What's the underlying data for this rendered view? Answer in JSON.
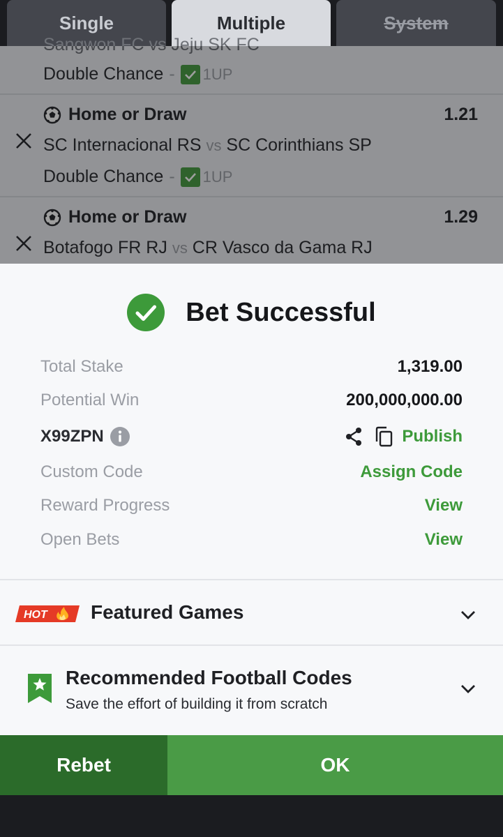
{
  "tabs": [
    {
      "label": "Single"
    },
    {
      "label": "Multiple"
    },
    {
      "label": "System"
    }
  ],
  "selections": [
    {
      "match_partial": "Sangwon FC vs Jeju SK FC",
      "market": "Double Chance",
      "pick": "1UP"
    },
    {
      "title": "Home or Draw",
      "odds": "1.21",
      "home": "SC Internacional RS",
      "vs": "vs",
      "away": "SC Corinthians SP",
      "market": "Double Chance",
      "pick": "1UP"
    },
    {
      "title": "Home or Draw",
      "odds": "1.29",
      "home": "Botafogo FR RJ",
      "vs": "vs",
      "away": "CR Vasco da Gama RJ"
    }
  ],
  "result": {
    "title": "Bet Successful",
    "total_stake_label": "Total Stake",
    "total_stake": "1,319.00",
    "potential_win_label": "Potential Win",
    "potential_win": "200,000,000.00",
    "booking_code": "X99ZPN",
    "publish_label": "Publish",
    "custom_code_label": "Custom Code",
    "assign_code_label": "Assign Code",
    "reward_progress_label": "Reward Progress",
    "reward_view_label": "View",
    "open_bets_label": "Open Bets",
    "open_bets_view_label": "View"
  },
  "featured": {
    "badge": "HOT",
    "title": "Featured Games"
  },
  "recommended": {
    "title": "Recommended Football Codes",
    "subtitle": "Save the effort of building it from scratch"
  },
  "footer": {
    "rebet_label": "Rebet",
    "ok_label": "OK"
  },
  "colors": {
    "accent_green": "#4a9b46",
    "dark_green": "#2b6b2a",
    "link_green": "#3d9a3a",
    "hot_red": "#e53a26"
  }
}
